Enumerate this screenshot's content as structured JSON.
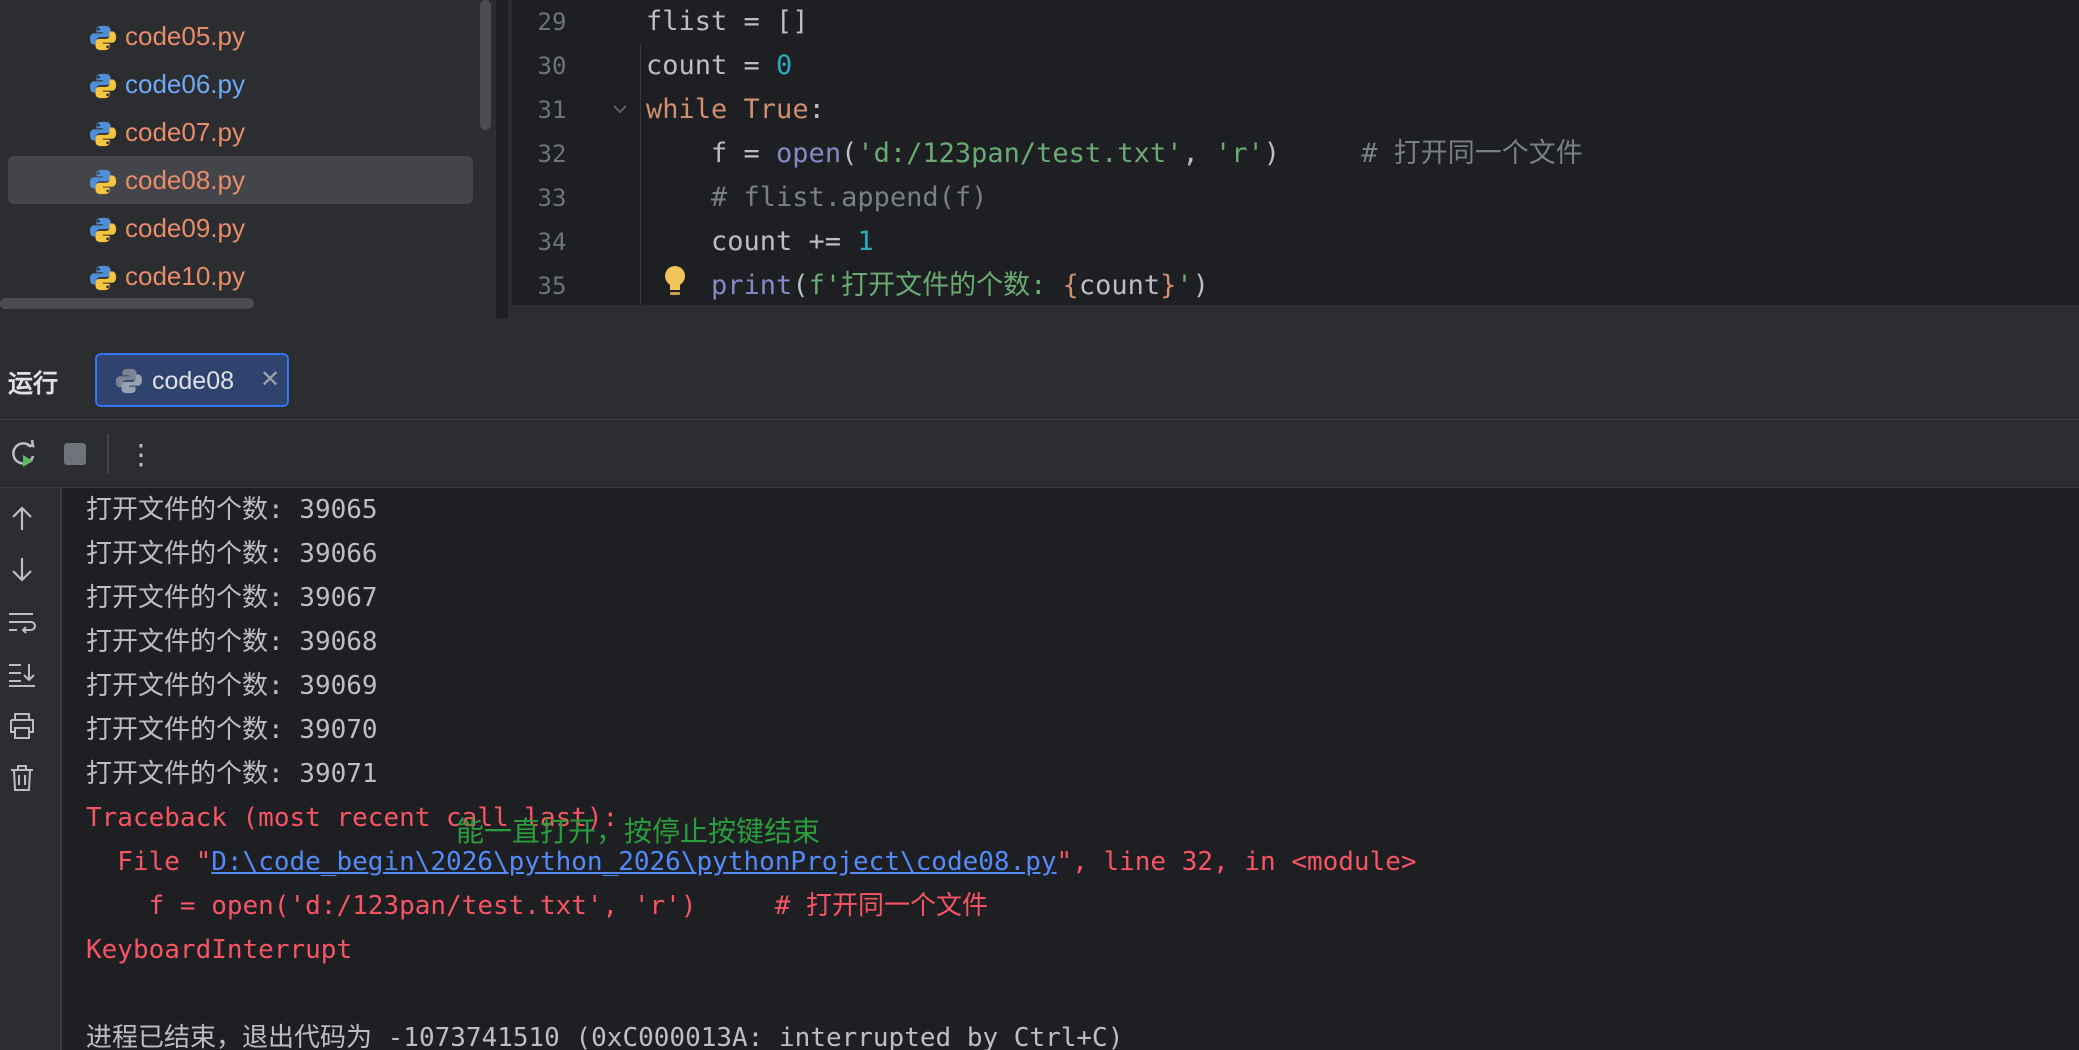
{
  "project_tree": {
    "files": [
      {
        "name": "code05.py",
        "status": "modified"
      },
      {
        "name": "code06.py",
        "status": "changed"
      },
      {
        "name": "code07.py",
        "status": "modified"
      },
      {
        "name": "code08.py",
        "status": "modified",
        "selected": true
      },
      {
        "name": "code09.py",
        "status": "modified"
      },
      {
        "name": "code10.py",
        "status": "modified"
      }
    ],
    "top_partial": "py"
  },
  "editor": {
    "lines": [
      {
        "num": "29"
      },
      {
        "num": "30"
      },
      {
        "num": "31"
      },
      {
        "num": "32"
      },
      {
        "num": "33"
      },
      {
        "num": "34"
      },
      {
        "num": "35"
      }
    ],
    "code": {
      "l29_a": "flist = []",
      "l30_a": "count = ",
      "l30_b": "0",
      "l31_a": "while",
      "l31_b": " ",
      "l31_c": "True",
      "l31_d": ":",
      "l32_a": "    f = ",
      "l32_b": "open",
      "l32_c": "(",
      "l32_d": "'d:/123pan/test.txt'",
      "l32_e": ", ",
      "l32_f": "'r'",
      "l32_g": ")     ",
      "l32_h": "# 打开同一个文件",
      "l33_a": "    # flist.append(f)",
      "l34_a": "    count += ",
      "l34_b": "1",
      "l35_a": "    ",
      "l35_b": "print",
      "l35_c": "(",
      "l35_d": "f'打开文件的个数: ",
      "l35_e": "{",
      "l35_f": "count",
      "l35_g": "}",
      "l35_h": "'",
      "l35_i": ")"
    }
  },
  "run": {
    "title": "运行",
    "tab_label": "code08",
    "tab_close": "✕",
    "toolbar": {
      "more": "⋮"
    }
  },
  "console": {
    "output": [
      "打开文件的个数: 39065",
      "打开文件的个数: 39066",
      "打开文件的个数: 39067",
      "打开文件的个数: 39068",
      "打开文件的个数: 39069",
      "打开文件的个数: 39070",
      "打开文件的个数: 39071"
    ],
    "traceback_header": "Traceback (most recent call last):",
    "file_prefix": "  File \"",
    "file_link": "D:\\code_begin\\2026\\python_2026\\pythonProject\\code08.py",
    "file_suffix": "\", line 32, in <module>",
    "code_line": "    f = open('d:/123pan/test.txt', 'r')     # 打开同一个文件",
    "exception": "KeyboardInterrupt",
    "exit_message": "进程已结束，退出代码为 -1073741510 (0xC000013A: interrupted by Ctrl+C)",
    "annotation": "能一直打开，按停止按键结束"
  },
  "colors": {
    "accent": "#3574f0",
    "error": "#f75464",
    "annotation": "#2a9d3c",
    "modified_file": "#e88c6a",
    "changed_file": "#6fa9f5"
  }
}
